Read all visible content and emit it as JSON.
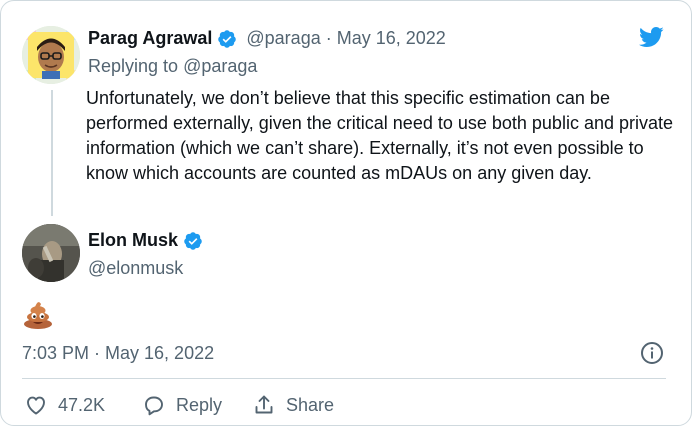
{
  "reply_tweet": {
    "author_name": "Parag Agrawal",
    "handle": "@paraga",
    "separator": "·",
    "date": "May 16, 2022",
    "replying_to_prefix": "Replying to",
    "replying_to_handle": "@paraga",
    "text": "Unfortunately, we don’t believe that this specific estimation can be performed externally, given the critical need to use both public and private information (which we can’t share). Externally, it’s not even possible to know which accounts are counted as mDAUs on any given day."
  },
  "main_tweet": {
    "author_name": "Elon Musk",
    "handle": "@elonmusk",
    "content_emoji": "pile-of-poo-emoji",
    "timestamp": "7:03 PM · May 16, 2022"
  },
  "actions": {
    "like_count": "47.2K",
    "reply_label": "Reply",
    "share_label": "Share"
  },
  "icons": {
    "brand": "twitter-bird-icon",
    "verified": "verified-badge-icon",
    "info": "info-icon",
    "like": "heart-icon",
    "reply": "reply-bubble-icon",
    "share": "share-icon"
  },
  "colors": {
    "twitter_blue": "#1d9bf0",
    "text_primary": "#0f1419",
    "text_secondary": "#536471",
    "border": "#cfd9de"
  }
}
